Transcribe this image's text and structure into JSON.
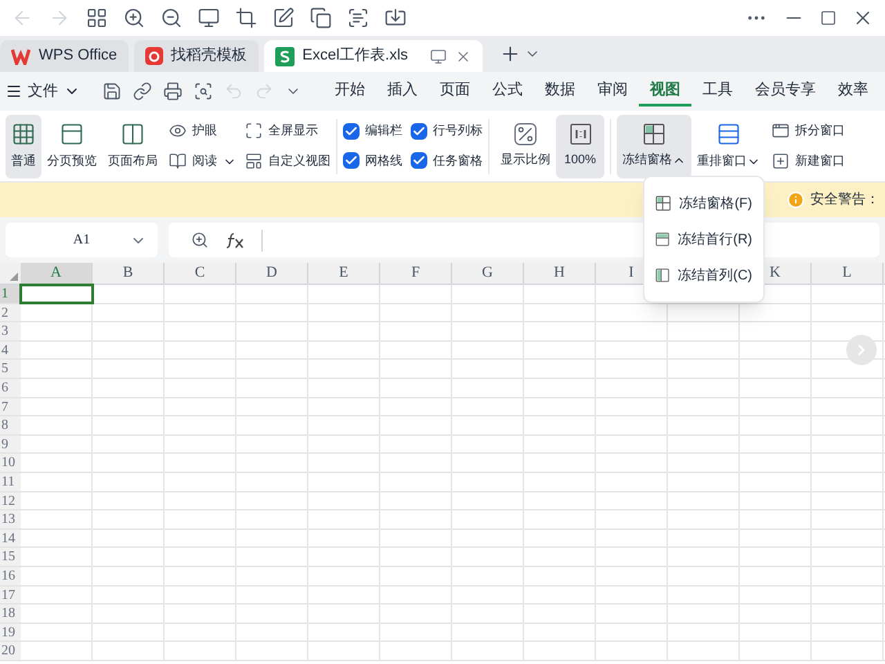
{
  "tabs": [
    {
      "label": "WPS Office",
      "kind": "wps",
      "selected": false
    },
    {
      "label": "找稻壳模板",
      "kind": "template",
      "selected": false
    },
    {
      "label": "Excel工作表.xls",
      "kind": "sheet",
      "selected": true
    }
  ],
  "menu": {
    "file": "文件",
    "quick_tools": [
      {
        "kind": "save",
        "disabled": false
      },
      {
        "kind": "link",
        "disabled": false
      },
      {
        "kind": "print",
        "disabled": false
      },
      {
        "kind": "preview",
        "disabled": false
      },
      {
        "kind": "undo",
        "disabled": true
      },
      {
        "kind": "redo",
        "disabled": true
      }
    ],
    "tabs": [
      {
        "label": "开始",
        "selected": false
      },
      {
        "label": "插入",
        "selected": false
      },
      {
        "label": "页面",
        "selected": false
      },
      {
        "label": "公式",
        "selected": false
      },
      {
        "label": "数据",
        "selected": false
      },
      {
        "label": "审阅",
        "selected": false
      },
      {
        "label": "视图",
        "selected": true
      },
      {
        "label": "工具",
        "selected": false
      },
      {
        "label": "会员专享",
        "selected": false
      },
      {
        "label": "效率",
        "selected": false
      }
    ]
  },
  "ribbon": {
    "views": [
      {
        "label": "普通",
        "kind": "normal",
        "selected": true
      },
      {
        "label": "分页预览",
        "kind": "pagebreak",
        "selected": false
      },
      {
        "label": "页面布局",
        "kind": "layout",
        "selected": false
      }
    ],
    "small": [
      {
        "label": "护眼",
        "kind": "eye"
      },
      {
        "label": "阅读",
        "kind": "read"
      },
      {
        "label": "全屏显示",
        "kind": "fullscreen"
      },
      {
        "label": "自定义视图",
        "kind": "custom"
      }
    ],
    "checkboxes": [
      {
        "label": "编辑栏",
        "checked": true
      },
      {
        "label": "行号列标",
        "checked": true
      },
      {
        "label": "网格线",
        "checked": true
      },
      {
        "label": "任务窗格",
        "checked": true
      }
    ],
    "zoom_ratio": "显示比例",
    "zoom_100": "100%",
    "freeze": {
      "label": "冻结窗格",
      "expanded": true
    },
    "arrange": "重排窗口",
    "split": "拆分窗口",
    "new_window": "新建窗口"
  },
  "security_bar": {
    "text": "安全警告："
  },
  "formula_bar": {
    "cell": "A1"
  },
  "grid": {
    "columns": [
      {
        "label": "A",
        "selected": true
      },
      {
        "label": "B",
        "selected": false
      },
      {
        "label": "C",
        "selected": false
      },
      {
        "label": "D",
        "selected": false
      },
      {
        "label": "E",
        "selected": false
      },
      {
        "label": "F",
        "selected": false
      },
      {
        "label": "G",
        "selected": false
      },
      {
        "label": "H",
        "selected": false
      },
      {
        "label": "I",
        "selected": false
      },
      {},
      {
        "label": "K",
        "selected": false
      },
      {
        "label": "L",
        "selected": false
      }
    ],
    "rows": [
      {
        "label": "1",
        "selected": true
      },
      {
        "label": "2",
        "selected": false
      },
      {
        "label": "3",
        "selected": false
      },
      {
        "label": "4",
        "selected": false
      },
      {
        "label": "5",
        "selected": false
      },
      {
        "label": "6",
        "selected": false
      },
      {
        "label": "7",
        "selected": false
      },
      {
        "label": "8",
        "selected": false
      },
      {
        "label": "9",
        "selected": false
      },
      {
        "label": "10",
        "selected": false
      },
      {
        "label": "11",
        "selected": false
      },
      {
        "label": "12",
        "selected": false
      },
      {
        "label": "13",
        "selected": false
      },
      {
        "label": "14",
        "selected": false
      },
      {
        "label": "15",
        "selected": false
      },
      {
        "label": "16",
        "selected": false
      },
      {
        "label": "17",
        "selected": false
      },
      {
        "label": "18",
        "selected": false
      },
      {
        "label": "19",
        "selected": false
      },
      {
        "label": "20",
        "selected": false
      }
    ]
  },
  "freeze_menu": [
    {
      "label": "冻结窗格(F)",
      "kind": "panes"
    },
    {
      "label": "冻结首行(R)",
      "kind": "row"
    },
    {
      "label": "冻结首列(C)",
      "kind": "column"
    }
  ]
}
